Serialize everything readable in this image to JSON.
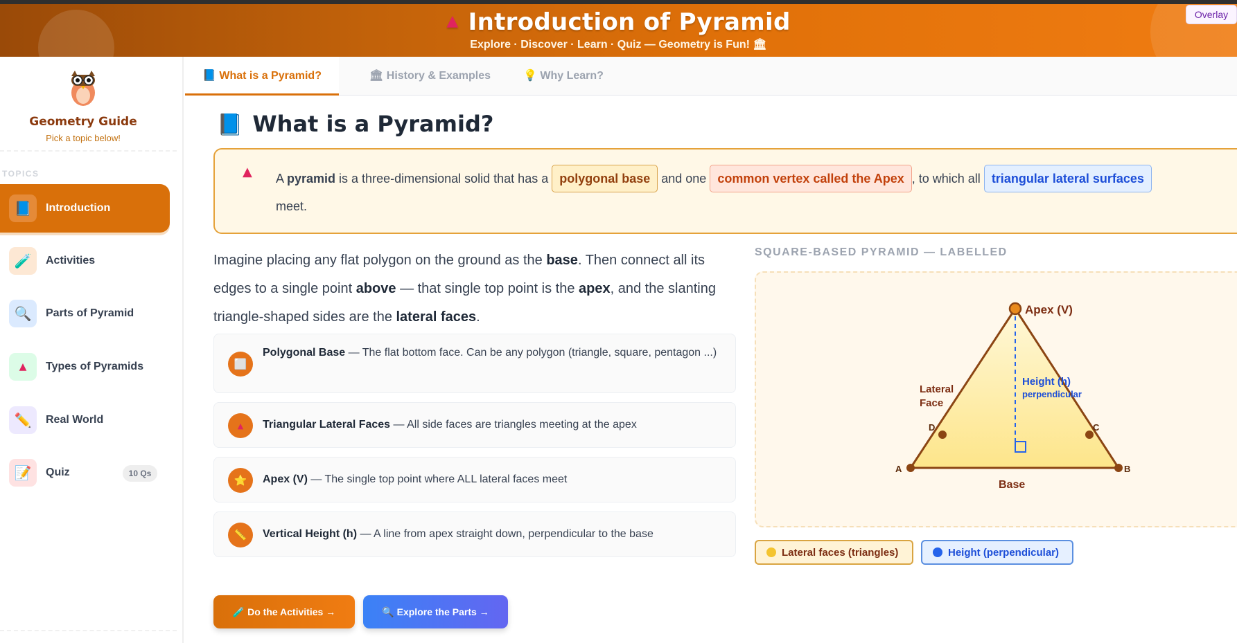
{
  "header": {
    "title": "Introduction of Pyramid",
    "subtitle": "Explore · Discover · Learn · Quiz — Geometry is Fun! 🏛",
    "overlay_label": "Overlay"
  },
  "sidebar": {
    "title": "Geometry Guide",
    "subtitle": "Pick a topic below!",
    "section_label": "TOPICS",
    "items": [
      {
        "label": "Introduction",
        "icon": "📘",
        "icon_bg": "#e58a38"
      },
      {
        "label": "Activities",
        "icon": "🧪",
        "icon_bg": "#fde8d4"
      },
      {
        "label": "Parts of Pyramid",
        "icon": "🔍",
        "icon_bg": "#dbeafe"
      },
      {
        "label": "Types of Pyramids",
        "icon": "▲",
        "icon_bg": "#dcfce7"
      },
      {
        "label": "Real World",
        "icon": "✏️",
        "icon_bg": "#ede9fe"
      },
      {
        "label": "Quiz",
        "icon": "📝",
        "icon_bg": "#fee2e2",
        "badge": "10 Qs"
      }
    ]
  },
  "tabs": [
    {
      "label": "📘 What is a Pyramid?"
    },
    {
      "label": "🏛 History & Examples"
    },
    {
      "label": "💡 Why Learn?"
    }
  ],
  "main": {
    "title": "What is a Pyramid?",
    "definition": {
      "a": "A ",
      "pyramid": "pyramid",
      "b": " is a three-dimensional solid that has a ",
      "chip1": "polygonal base",
      "c": " and one ",
      "chip2": "common vertex called the Apex",
      "d": ", to which all ",
      "chip3": "triangular lateral surfaces",
      "e": "meet."
    },
    "intro": {
      "p1": "Imagine placing any flat polygon on the ground as the ",
      "base": "base",
      "p2": ". Then connect all its edges to a single point ",
      "above": "above",
      "p3": " — that single top point is the ",
      "apex": "apex",
      "p4": ", and the slanting triangle-shaped sides are the ",
      "lateral": "lateral faces",
      "p5": "."
    },
    "features": [
      {
        "icon": "⬜",
        "term": "Polygonal Base",
        "desc": " — The flat bottom face. Can be any polygon (triangle, square, pentagon ...)"
      },
      {
        "icon": "▲",
        "term": "Triangular Lateral Faces",
        "desc": " — All side faces are triangles meeting at the apex"
      },
      {
        "icon": "⭐",
        "term": "Apex (V)",
        "desc": " — The single top point where ALL lateral faces meet"
      },
      {
        "icon": "📏",
        "term": "Vertical Height (h)",
        "desc": " — A line from apex straight down, perpendicular to the base"
      }
    ],
    "buttons": {
      "activities": "🧪 Do the Activities →",
      "parts": "🔍 Explore the Parts →"
    }
  },
  "diagram": {
    "label": "SQUARE-BASED PYRAMID — LABELLED",
    "apex": "Apex (V)",
    "height1": "Height (h)",
    "height2": "perpendicular",
    "lateral1": "Lateral",
    "lateral2": "Face",
    "base": "Base",
    "A": "A",
    "B": "B",
    "C": "C",
    "D": "D",
    "legend": [
      {
        "label": "Lateral faces (triangles)",
        "color": "#f4c430"
      },
      {
        "label": "Height (perpendicular)",
        "color": "#2563eb"
      }
    ]
  }
}
